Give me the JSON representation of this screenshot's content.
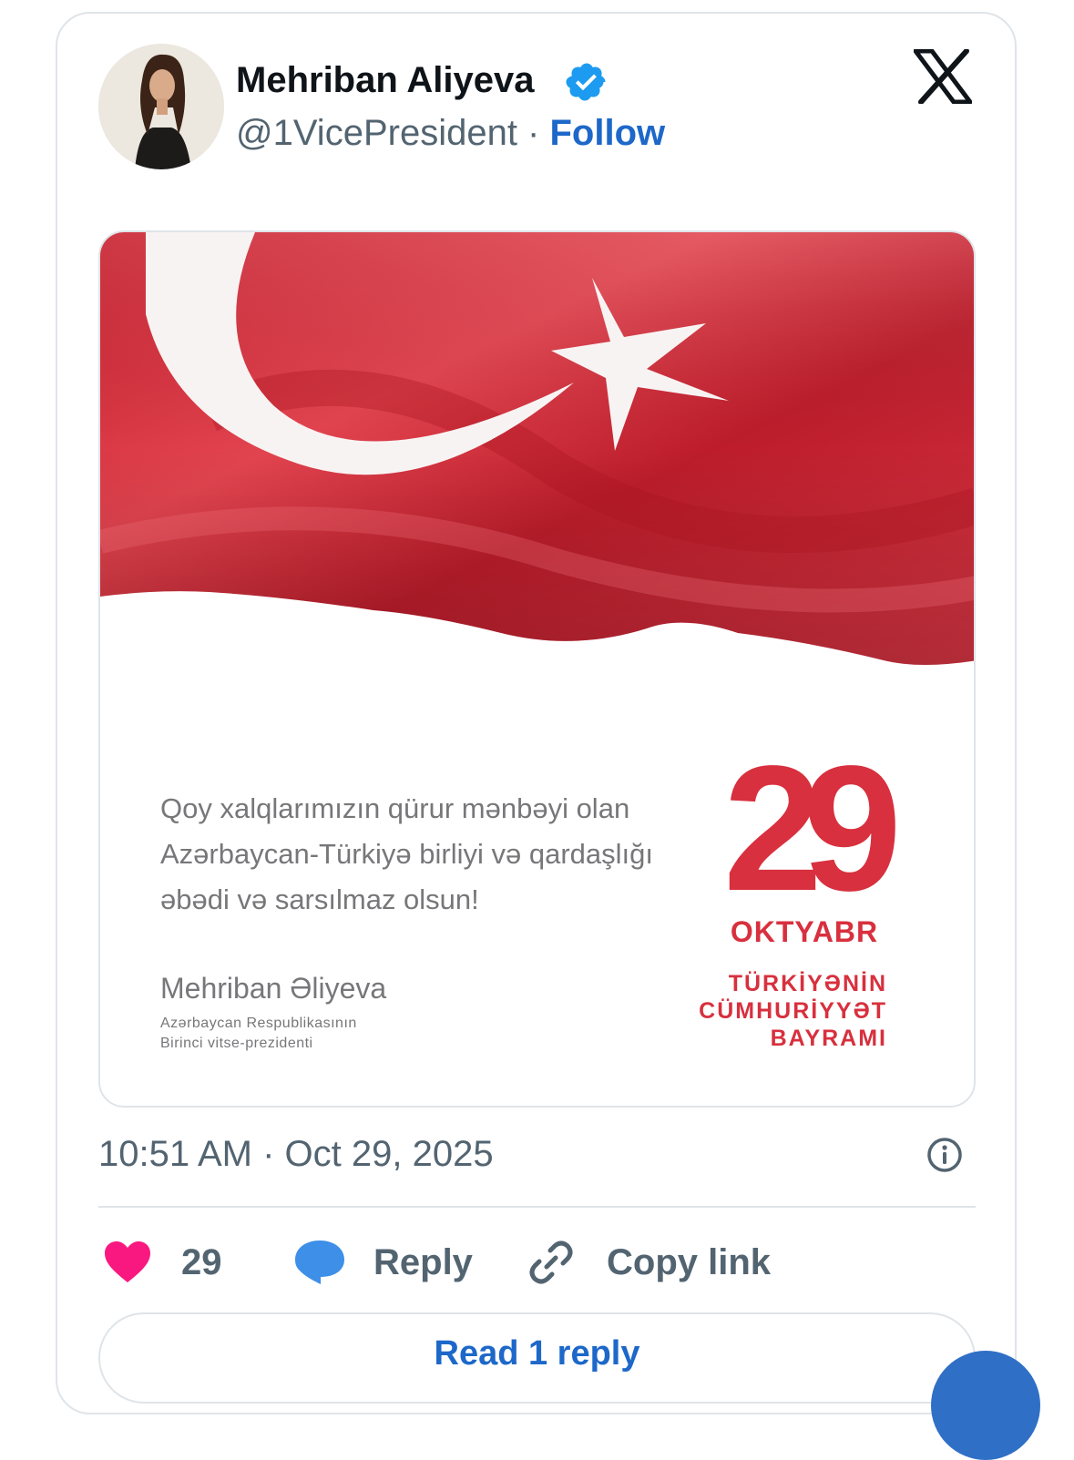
{
  "tweet": {
    "author_name": "Mehriban Aliyeva",
    "handle": "@1VicePresident",
    "separator": " · ",
    "follow_label": "Follow",
    "timestamp": "10:51 AM · Oct 29, 2025"
  },
  "media": {
    "quote_lines": [
      "Qoy xalqlarımızın qürur mənbəyi olan",
      "Azərbaycan-Türkiyə birliyi və qardaşlığı",
      "əbədi və sarsılmaz olsun!"
    ],
    "signature_name": "Mehriban Əliyeva",
    "signature_title_lines": [
      "Azərbaycan Respublikasının",
      "Birinci vitse-prezidenti"
    ],
    "date_number": "29",
    "date_month": "OKTYABR",
    "holiday_lines": [
      "TÜRKİYƏNİN",
      "CÜMHURİYYƏT",
      "BAYRAMI"
    ]
  },
  "actions": {
    "like_count": "29",
    "reply_label": "Reply",
    "copy_link_label": "Copy link",
    "read_replies_label": "Read 1 reply"
  },
  "icons": {
    "verified": "verified-badge-icon",
    "brand": "x-logo-icon",
    "info": "info-icon",
    "like": "heart-icon",
    "reply": "speech-bubble-icon",
    "copy": "link-icon"
  },
  "colors": {
    "link_blue": "#1d68c9",
    "verified_blue": "#1d9bf0",
    "heart_pink": "#f91880",
    "reply_bubble": "#3d8fe8",
    "flag_red": "#d8303e",
    "text_gray": "#536471"
  }
}
